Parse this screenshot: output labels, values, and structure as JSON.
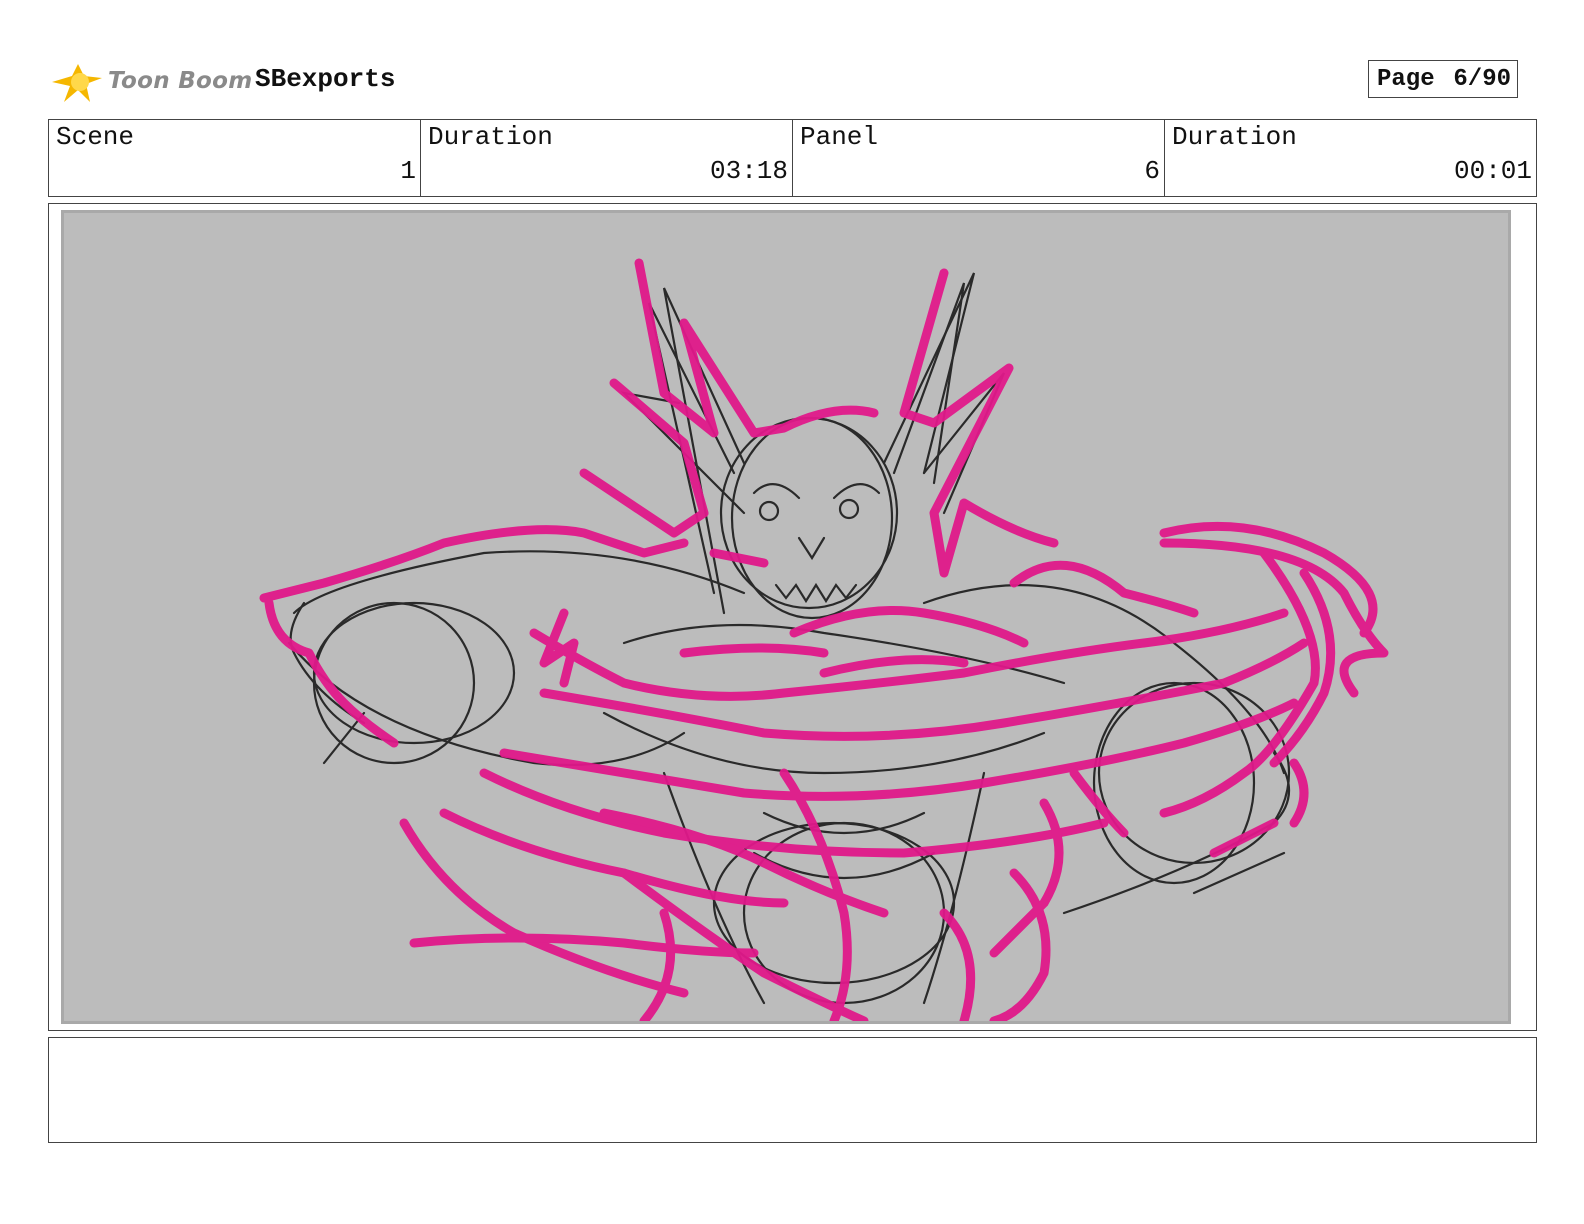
{
  "header": {
    "brand": "Toon Boom",
    "project": "SBexports",
    "page_label": "Page",
    "page_value": "6/90"
  },
  "info": {
    "scene_label": "Scene",
    "scene_value": "1",
    "scene_duration_label": "Duration",
    "scene_duration_value": "03:18",
    "panel_label": "Panel",
    "panel_value": "6",
    "panel_duration_label": "Duration",
    "panel_duration_value": "00:01"
  },
  "drawing": {
    "background_color": "#bcbcbc",
    "line_color": "#111111",
    "effect_color": "#e0198a"
  },
  "notes": {
    "text": ""
  }
}
